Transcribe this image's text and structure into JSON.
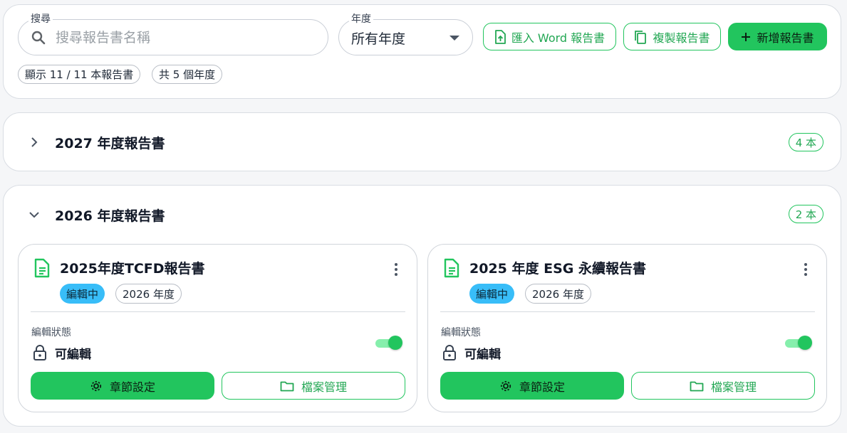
{
  "toolbar": {
    "search": {
      "label": "搜尋",
      "placeholder": "搜尋報告書名稱",
      "value": ""
    },
    "year_select": {
      "label": "年度",
      "value": "所有年度"
    },
    "import_label": "匯入 Word 報告書",
    "copy_label": "複製報告書",
    "add_label": "新增報告書",
    "count_chip": "顯示 11 / 11 本報告書",
    "years_chip": "共 5 個年度"
  },
  "groups": [
    {
      "title": "2027 年度報告書",
      "count": "4 本",
      "expanded": false
    },
    {
      "title": "2026 年度報告書",
      "count": "2 本",
      "expanded": true,
      "cards": [
        {
          "title": "2025年度TCFD報告書",
          "status": "編輯中",
          "year": "2026 年度",
          "edit_state_label": "編輯狀態",
          "edit_state_value": "可編輯",
          "editable": true,
          "primary_label": "章節設定",
          "secondary_label": "檔案管理"
        },
        {
          "title": "2025 年度 ESG 永續報告書",
          "status": "編輯中",
          "year": "2026 年度",
          "edit_state_label": "編輯狀態",
          "edit_state_value": "可編輯",
          "editable": true,
          "primary_label": "章節設定",
          "secondary_label": "檔案管理"
        }
      ]
    }
  ],
  "colors": {
    "accent": "#22c55e",
    "status_badge": "#38bdf8"
  }
}
